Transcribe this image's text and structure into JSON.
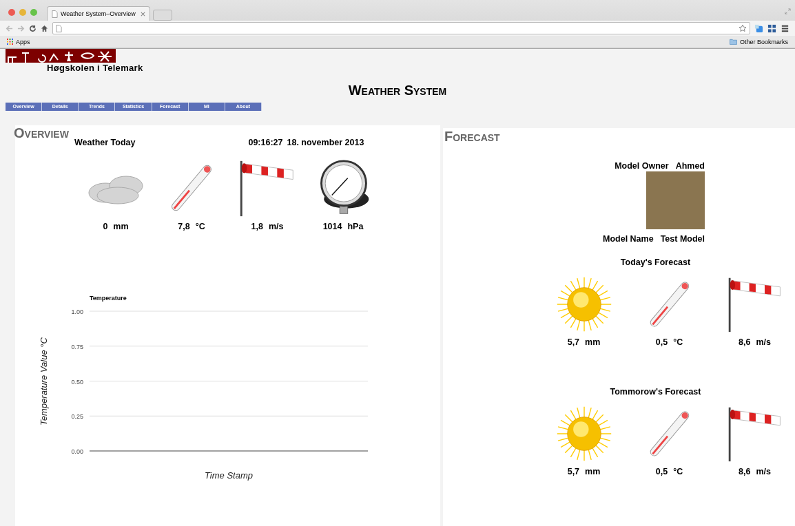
{
  "browser": {
    "tab_title": "Weather System–Overview",
    "bookmarks": [
      "Apps",
      "Other Bookmarks"
    ]
  },
  "header": {
    "institution": "Høgskolen i Telemark",
    "title": "Weather System"
  },
  "nav": [
    {
      "label": "Overview",
      "selected": false
    },
    {
      "label": "Details",
      "selected": false
    },
    {
      "label": "Trends",
      "selected": false
    },
    {
      "label": "Statistics",
      "selected": false
    },
    {
      "label": "Forecast",
      "selected": false
    },
    {
      "label": "MI",
      "selected": false
    },
    {
      "label": "About",
      "selected": false
    }
  ],
  "overview": {
    "heading": "Overview",
    "subtitle": "Weather Today",
    "time": "09:16:27",
    "date": "18. november 2013",
    "readings": [
      {
        "kind": "cloud",
        "value": "0",
        "unit": "mm"
      },
      {
        "kind": "temperature",
        "value": "7,8",
        "unit": "°C"
      },
      {
        "kind": "wind",
        "value": "1,8",
        "unit": "m/s"
      },
      {
        "kind": "pressure",
        "value": "1014",
        "unit": "hPa"
      }
    ],
    "temperature_chart": {
      "title": "Temperature",
      "xlabel": "Time Stamp",
      "ylabel": "Temperature Value °C",
      "yticks": [
        "1.00",
        "0.75",
        "0.50",
        "0.25",
        "0.00"
      ]
    }
  },
  "forecast": {
    "heading": "Forecast",
    "owner_label": "Model Owner",
    "owner": "Ahmed",
    "name_label": "Model Name",
    "name": "Test Model",
    "sections": [
      {
        "title": "Today's Forecast",
        "readings": [
          {
            "kind": "sun",
            "value": "5,7",
            "unit": "mm"
          },
          {
            "kind": "temperature",
            "value": "0,5",
            "unit": "°C"
          },
          {
            "kind": "wind",
            "value": "8,6",
            "unit": "m/s"
          }
        ]
      },
      {
        "title": "Tommorow's Forecast",
        "readings": [
          {
            "kind": "sun",
            "value": "5,7",
            "unit": "mm"
          },
          {
            "kind": "temperature",
            "value": "0,5",
            "unit": "°C"
          },
          {
            "kind": "wind",
            "value": "8,6",
            "unit": "m/s"
          }
        ]
      }
    ]
  }
}
